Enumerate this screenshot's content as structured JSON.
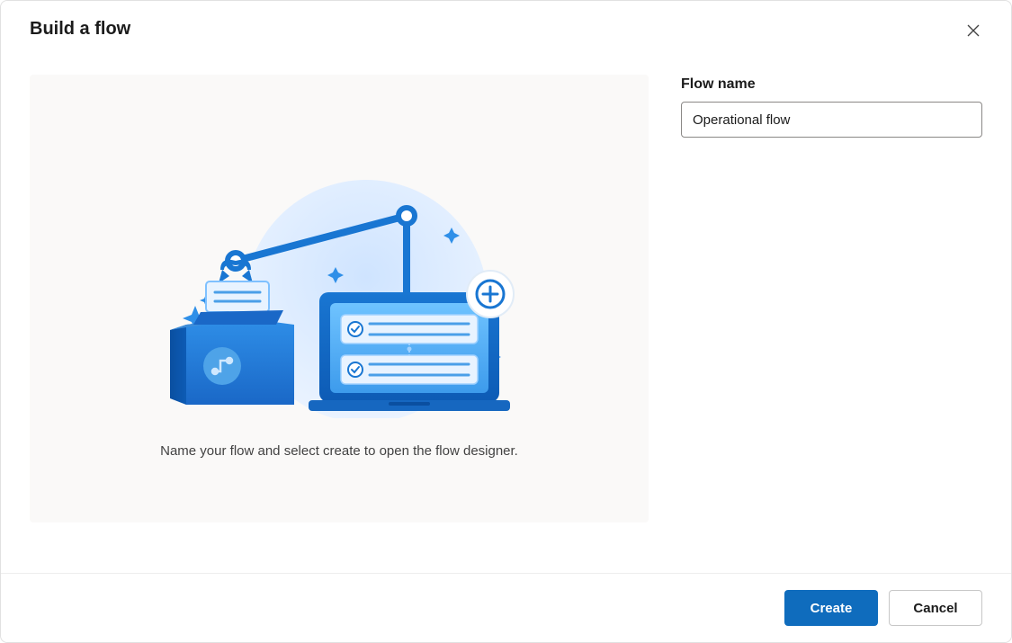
{
  "dialog": {
    "title": "Build a flow",
    "helperText": "Name your flow and select create to open the flow designer."
  },
  "form": {
    "flowName": {
      "label": "Flow name",
      "value": "Operational flow"
    }
  },
  "footer": {
    "primaryLabel": "Create",
    "secondaryLabel": "Cancel"
  }
}
